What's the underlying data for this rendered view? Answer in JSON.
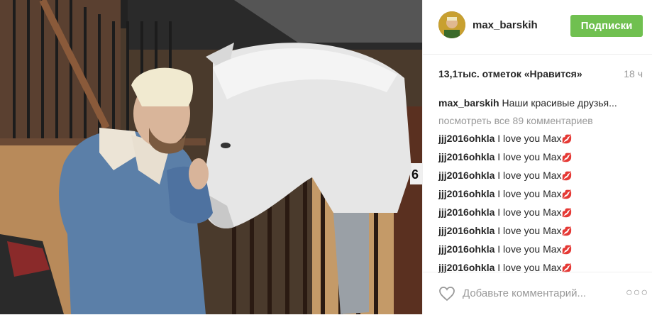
{
  "post": {
    "username": "max_barskih",
    "follow_label": "Подписки",
    "likes": "13,1тыс. отметок «Нравится»",
    "time": "18 ч",
    "caption_user": "max_barskih",
    "caption_text": "Наши красивые друзья...",
    "view_all": "посмотреть все 89 комментариев",
    "comments": [
      {
        "user": "jjj2016ohkla",
        "text": "I love you Max",
        "emoji": "💋"
      },
      {
        "user": "jjj2016ohkla",
        "text": "I love you Max",
        "emoji": "💋"
      },
      {
        "user": "jjj2016ohkla",
        "text": "I love you Max",
        "emoji": "💋"
      },
      {
        "user": "jjj2016ohkla",
        "text": "I love you Max",
        "emoji": "💋"
      },
      {
        "user": "jjj2016ohkla",
        "text": "I love you Max",
        "emoji": "💋"
      },
      {
        "user": "jjj2016ohkla",
        "text": "I love you Max",
        "emoji": "💋"
      },
      {
        "user": "jjj2016ohkla",
        "text": "I love you Max",
        "emoji": "💋"
      },
      {
        "user": "jjj2016ohkla",
        "text": "I love you Max",
        "emoji": "💋"
      }
    ],
    "add_comment_placeholder": "Добавьте комментарий...",
    "more_label": "○○○",
    "stall_number": "6"
  },
  "colors": {
    "follow_button": "#70c050",
    "muted": "#999999",
    "text": "#262626"
  },
  "icons": {
    "like": "heart-outline-icon",
    "more": "more-options-icon"
  }
}
